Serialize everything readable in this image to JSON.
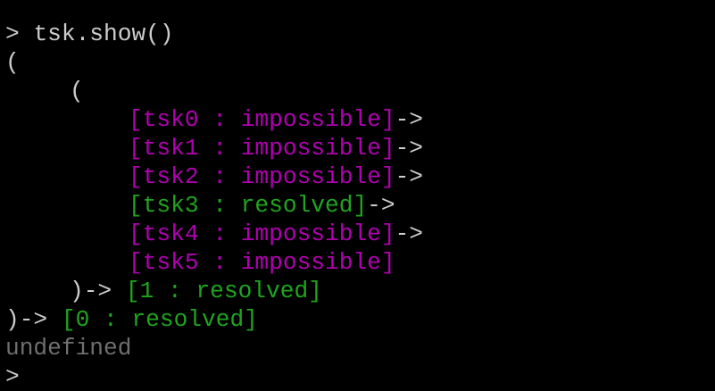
{
  "terminal": {
    "prompt_symbol": ">",
    "command": "tsk.show()",
    "open_paren_outer": "(",
    "open_paren_inner": "(",
    "tasks": [
      {
        "text": "[tsk0 : impossible]",
        "status": "impossible",
        "arrow": "->"
      },
      {
        "text": "[tsk1 : impossible]",
        "status": "impossible",
        "arrow": "->"
      },
      {
        "text": "[tsk2 : impossible]",
        "status": "impossible",
        "arrow": "->"
      },
      {
        "text": "[tsk3 : resolved]",
        "status": "resolved",
        "arrow": "->"
      },
      {
        "text": "[tsk4 : impossible]",
        "status": "impossible",
        "arrow": "->"
      },
      {
        "text": "[tsk5 : impossible]",
        "status": "impossible",
        "arrow": ""
      }
    ],
    "inner_close": ")->",
    "inner_result": "[1 : resolved]",
    "outer_close": ")->",
    "outer_result": "[0 : resolved]",
    "return_value": "undefined",
    "next_prompt": ">"
  },
  "colors": {
    "background": "#000000",
    "plain": "#cccccc",
    "impossible": "#b000b0",
    "resolved": "#1fa51f",
    "undefined": "#6f6f6f"
  }
}
